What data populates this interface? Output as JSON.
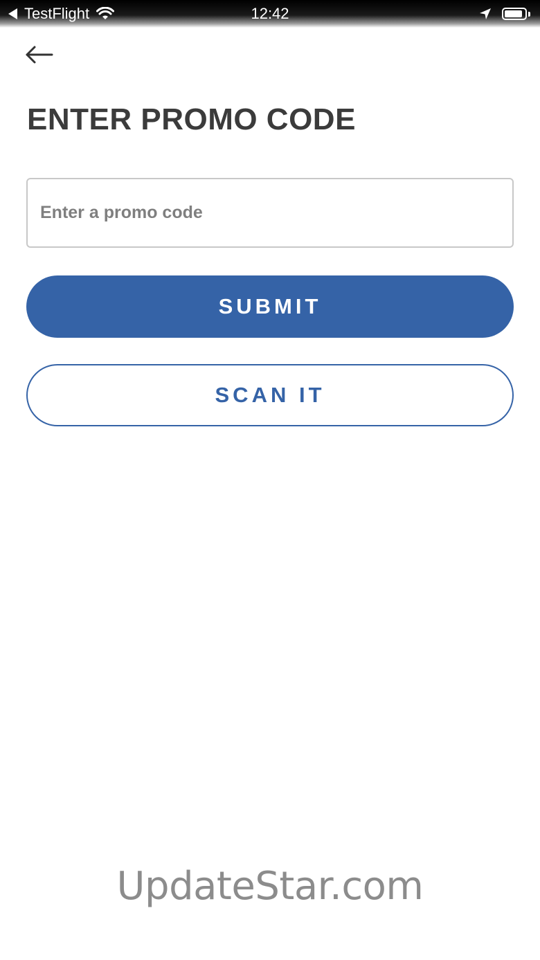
{
  "status_bar": {
    "back_app": "TestFlight",
    "time": "12:42",
    "battery_level": 0.9,
    "icons": [
      "back-triangle-icon",
      "wifi-icon",
      "location-arrow-icon",
      "battery-icon"
    ]
  },
  "nav": {
    "back_icon": "arrow-left-icon"
  },
  "page": {
    "title": "ENTER PROMO CODE"
  },
  "promo_input": {
    "placeholder": "Enter a promo code",
    "value": ""
  },
  "buttons": {
    "submit_label": "SUBMIT",
    "scan_label": "SCAN IT"
  },
  "colors": {
    "primary": "#3563a7",
    "title_text": "#3b3b3b",
    "input_border": "#c8c8c8",
    "placeholder": "#7f7f7f"
  },
  "watermark": "UpdateStar.com"
}
